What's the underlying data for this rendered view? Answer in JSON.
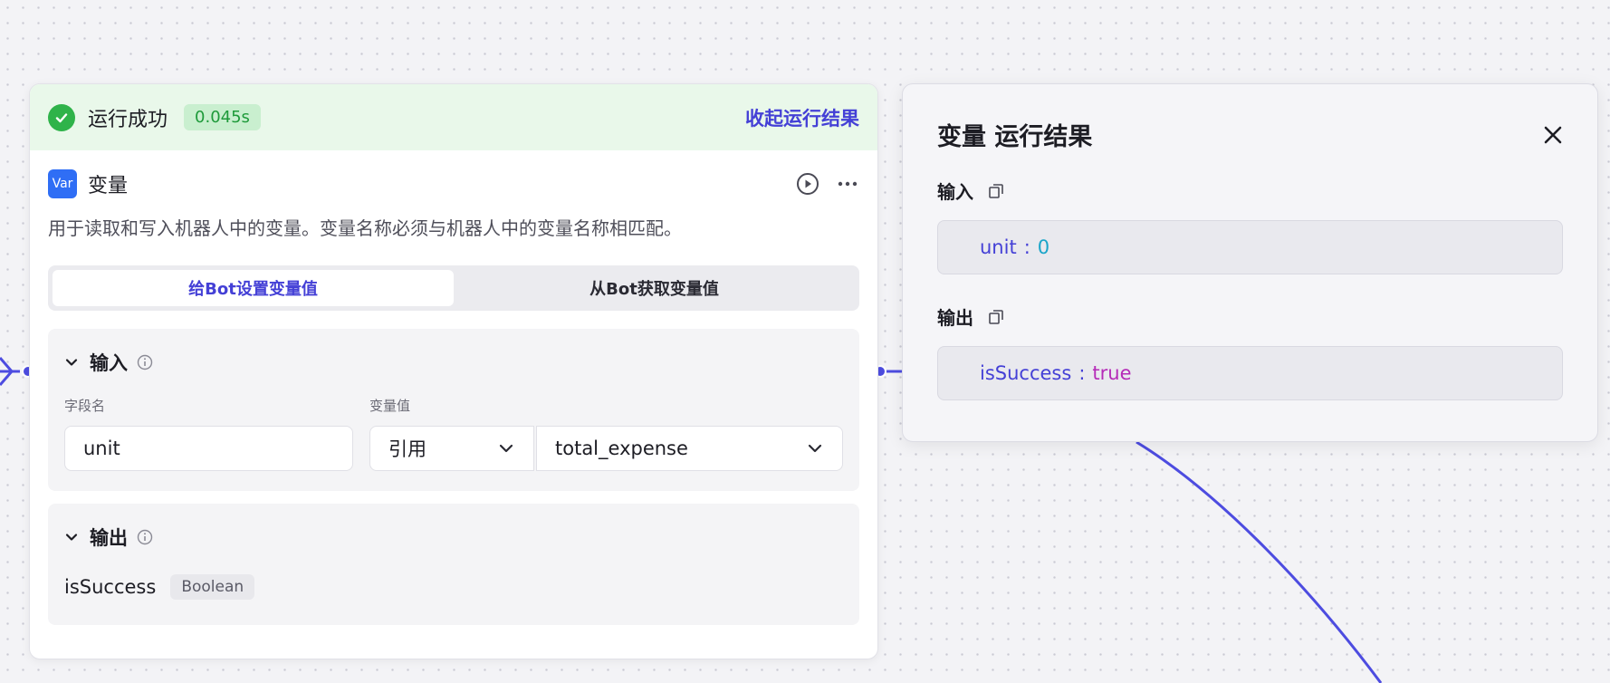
{
  "node": {
    "run_status": "运行成功",
    "run_time": "0.045s",
    "collapse_label": "收起运行结果",
    "badge": "Var",
    "title": "变量",
    "description": "用于读取和写入机器人中的变量。变量名称必须与机器人中的变量名称相匹配。",
    "tabs": [
      {
        "label": "给Bot设置变量值",
        "active": true
      },
      {
        "label": "从Bot获取变量值",
        "active": false
      }
    ],
    "input": {
      "title": "输入",
      "field_label": "字段名",
      "value_label": "变量值",
      "field_value": "unit",
      "ref_type": "引用",
      "ref_value": "total_expense"
    },
    "output": {
      "title": "输出",
      "name": "isSuccess",
      "type": "Boolean"
    }
  },
  "result_panel": {
    "title": "变量 运行结果",
    "input_label": "输入",
    "input_key": "unit",
    "input_value": "0",
    "output_label": "输出",
    "output_key": "isSuccess",
    "output_value": "true",
    "separator": ":"
  },
  "colors": {
    "accent": "#4440d6",
    "success": "#2fb34a",
    "badge": "#2f6ef5"
  }
}
